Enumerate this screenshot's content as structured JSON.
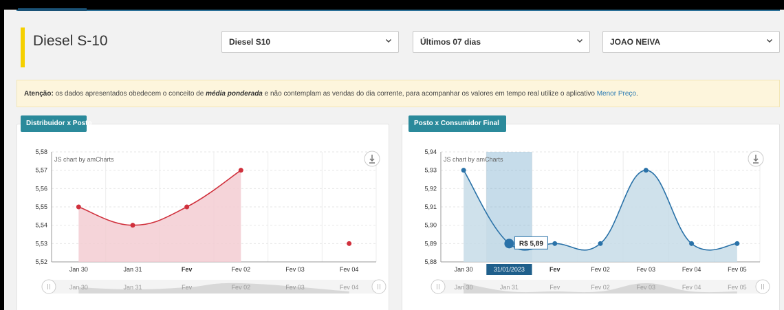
{
  "header": {
    "title": "Diesel S-10",
    "fuel_select": "Diesel S10",
    "period_select": "Últimos 07 dias",
    "city_select": "JOAO NEIVA"
  },
  "warning": {
    "label": "Atenção:",
    "text_before": " os dados apresentados obedecem o conceito de ",
    "emphasis": "média ponderada",
    "text_after": " e não contemplam as vendas do dia corrente, para acompanhar os valores em tempo real utilize o aplicativo ",
    "link": "Menor Preço",
    "end": "."
  },
  "chart_data": [
    {
      "type": "area",
      "tab_label": "Distribuidor x Posto",
      "watermark": "JS chart by amCharts",
      "categories": [
        "Jan 30",
        "Jan 31",
        "Fev",
        "Fev 02",
        "Fev 03",
        "Fev 04"
      ],
      "bold_categories": [
        "Fev"
      ],
      "values": [
        5.55,
        5.54,
        5.55,
        5.57,
        null,
        5.53
      ],
      "filled_range": [
        0,
        3
      ],
      "ylim": [
        5.52,
        5.58
      ],
      "yticks": [
        "5,58",
        "5,57",
        "5,56",
        "5,55",
        "5,54",
        "5,53",
        "5,52"
      ],
      "color": "#d0303c",
      "fill": "#f3ccd2",
      "scrollbar_labels": [
        "Jan 30",
        "Jan 31",
        "Fev",
        "Fev 02",
        "Fev 03",
        "Fev 04"
      ]
    },
    {
      "type": "area",
      "tab_label": "Posto x Consumidor Final",
      "watermark": "JS chart by amCharts",
      "categories": [
        "Jan 30",
        "Jan 31",
        "Fev",
        "Fev 02",
        "Fev 03",
        "Fev 04",
        "Fev 05"
      ],
      "bold_categories": [
        "Fev"
      ],
      "values": [
        5.93,
        5.89,
        5.89,
        5.89,
        5.93,
        5.89,
        5.89
      ],
      "ylim": [
        5.88,
        5.94
      ],
      "yticks": [
        "5,94",
        "5,93",
        "5,92",
        "5,91",
        "5,90",
        "5,89",
        "5,88"
      ],
      "color": "#2a72a8",
      "fill": "#c7dce8",
      "highlight_index": 1,
      "tooltip": "R$ 5,89",
      "cursor_label": "31/01/2023",
      "scrollbar_labels": [
        "Jan 30",
        "Jan 31",
        "Fev",
        "Fev 02",
        "Fev 03",
        "Fev 04",
        "Fev 05"
      ]
    }
  ]
}
